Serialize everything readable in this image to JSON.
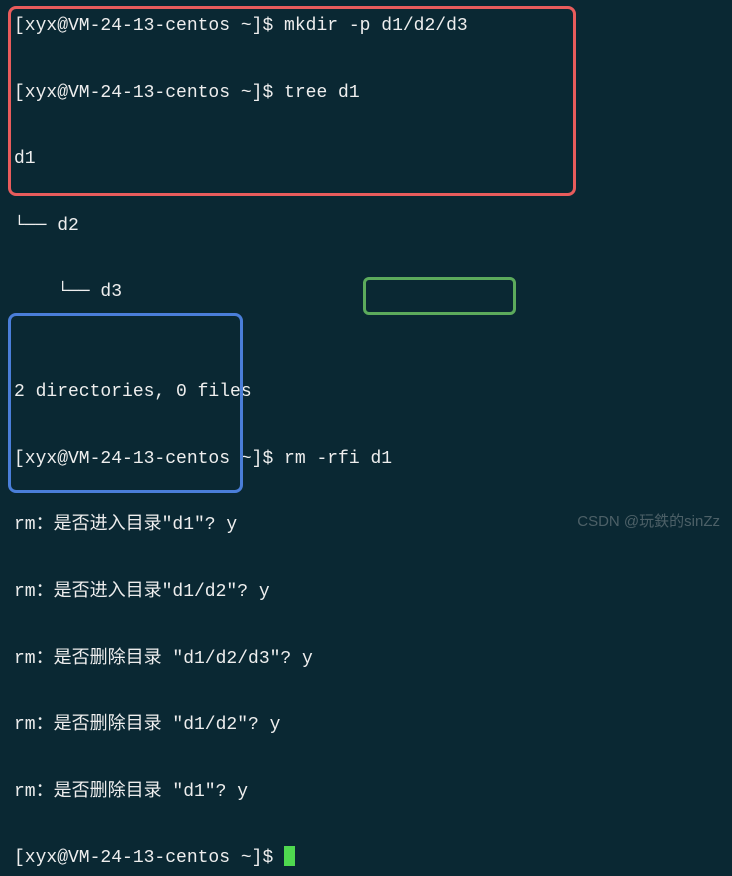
{
  "prompt": "[xyx@VM-24-13-centos ~]$ ",
  "lines": {
    "l1_cmd": "mkdir -p d1/d2/d3",
    "l2_cmd": "tree d1",
    "l3": "d1",
    "l4": "└── d2",
    "l5": "    └── d3",
    "l6": "",
    "l7": "2 directories, 0 files",
    "l8_cmd": "rm -rfi d1",
    "l9": "rm：是否进入目录\"d1\"? y",
    "l10": "rm：是否进入目录\"d1/d2\"? y",
    "l11": "rm：是否删除目录 \"d1/d2/d3\"? y",
    "l12": "rm：是否删除目录 \"d1/d2\"? y",
    "l13": "rm：是否删除目录 \"d1\"? y"
  },
  "watermark": "CSDN @玩鉄的sinZz"
}
